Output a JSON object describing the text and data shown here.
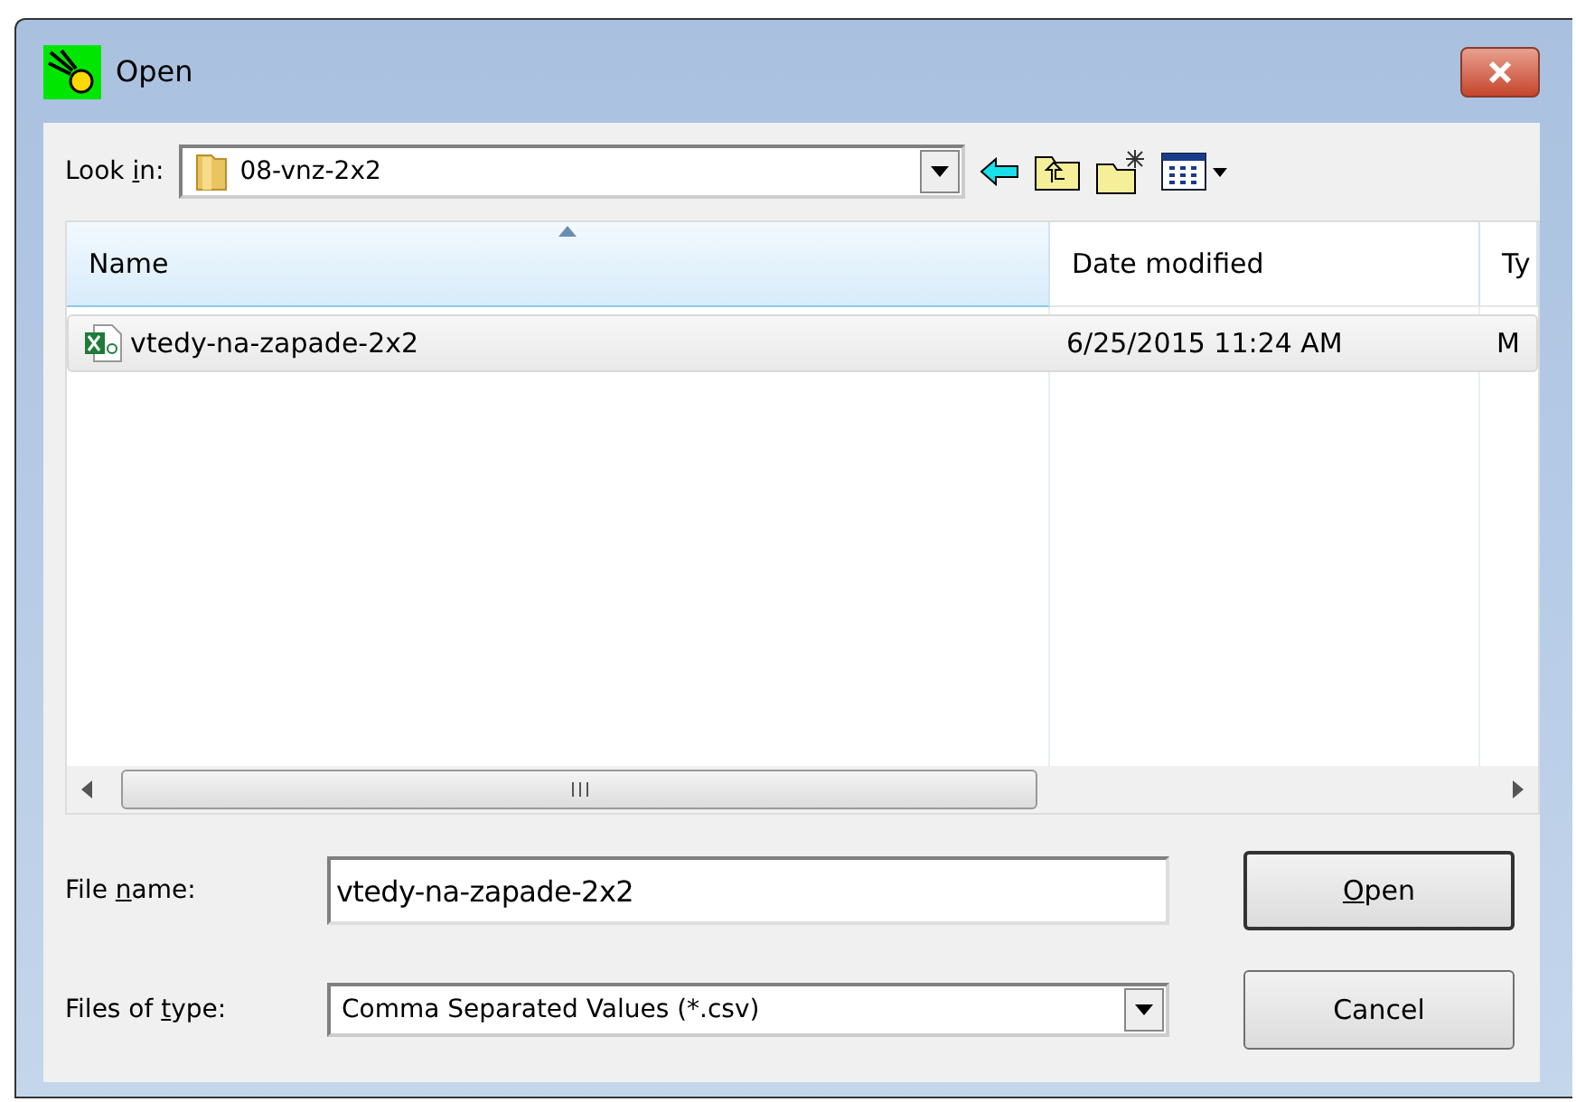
{
  "window": {
    "title": "Open"
  },
  "look_in": {
    "label": {
      "before": "Look ",
      "mnemonic": "i",
      "after": "n:"
    },
    "value": "08-vnz-2x2"
  },
  "columns": [
    {
      "label": "Name",
      "sorted": true
    },
    {
      "label": "Date modified",
      "sorted": false
    },
    {
      "label": "Ty",
      "sorted": false
    }
  ],
  "rows": [
    {
      "name": "vtedy-na-zapade-2x2",
      "date": "6/25/2015 11:24 AM",
      "type": "M",
      "selected": true
    }
  ],
  "file_name": {
    "label": {
      "before": "File ",
      "mnemonic": "n",
      "after": "ame:"
    },
    "value": "vtedy-na-zapade-2x2"
  },
  "file_type": {
    "label": {
      "before": "Files of ",
      "mnemonic": "t",
      "after": "ype:"
    },
    "value": "Comma Separated Values (*.csv)"
  },
  "buttons": [
    {
      "label": {
        "mnemonic": "O",
        "after": "pen"
      },
      "default": true
    },
    {
      "label": {
        "before": "Cancel"
      },
      "default": false
    }
  ]
}
